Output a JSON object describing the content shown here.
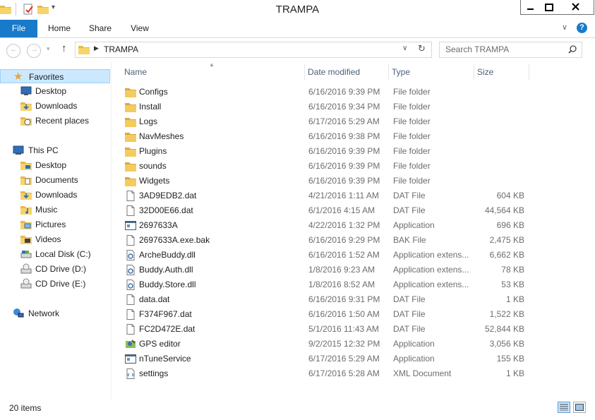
{
  "window": {
    "title": "TRAMPA"
  },
  "ribbon": {
    "tabs": [
      "File",
      "Home",
      "Share",
      "View"
    ],
    "help": "?"
  },
  "address": {
    "path": "TRAMPA"
  },
  "search": {
    "placeholder": "Search TRAMPA"
  },
  "nav": {
    "favorites": {
      "label": "Favorites",
      "items": [
        "Desktop",
        "Downloads",
        "Recent places"
      ]
    },
    "this_pc": {
      "label": "This PC",
      "items": [
        "Desktop",
        "Documents",
        "Downloads",
        "Music",
        "Pictures",
        "Videos",
        "Local Disk (C:)",
        "CD Drive (D:)",
        "CD Drive (E:)"
      ]
    },
    "network": {
      "label": "Network"
    }
  },
  "columns": {
    "name": "Name",
    "date": "Date modified",
    "type": "Type",
    "size": "Size"
  },
  "files": [
    {
      "name": "Configs",
      "date": "6/16/2016 9:39 PM",
      "type": "File folder",
      "size": "",
      "icon": "folder-icon"
    },
    {
      "name": "Install",
      "date": "6/16/2016 9:34 PM",
      "type": "File folder",
      "size": "",
      "icon": "folder-icon"
    },
    {
      "name": "Logs",
      "date": "6/17/2016 5:29 AM",
      "type": "File folder",
      "size": "",
      "icon": "folder-icon"
    },
    {
      "name": "NavMeshes",
      "date": "6/16/2016 9:38 PM",
      "type": "File folder",
      "size": "",
      "icon": "folder-icon"
    },
    {
      "name": "Plugins",
      "date": "6/16/2016 9:39 PM",
      "type": "File folder",
      "size": "",
      "icon": "folder-icon"
    },
    {
      "name": "sounds",
      "date": "6/16/2016 9:39 PM",
      "type": "File folder",
      "size": "",
      "icon": "folder-icon"
    },
    {
      "name": "Widgets",
      "date": "6/16/2016 9:39 PM",
      "type": "File folder",
      "size": "",
      "icon": "folder-icon"
    },
    {
      "name": "3AD9EDB2.dat",
      "date": "4/21/2016 1:11 AM",
      "type": "DAT File",
      "size": "604 KB",
      "icon": "file-icon"
    },
    {
      "name": "32D00E66.dat",
      "date": "6/1/2016 4:15 AM",
      "type": "DAT File",
      "size": "44,564 KB",
      "icon": "file-icon"
    },
    {
      "name": "2697633A",
      "date": "4/22/2016 1:32 PM",
      "type": "Application",
      "size": "696 KB",
      "icon": "application-icon"
    },
    {
      "name": "2697633A.exe.bak",
      "date": "6/16/2016 9:29 PM",
      "type": "BAK File",
      "size": "2,475 KB",
      "icon": "file-icon"
    },
    {
      "name": "ArcheBuddy.dll",
      "date": "6/16/2016 1:52 AM",
      "type": "Application extens...",
      "size": "6,662 KB",
      "icon": "dll-icon"
    },
    {
      "name": "Buddy.Auth.dll",
      "date": "1/8/2016 9:23 AM",
      "type": "Application extens...",
      "size": "78 KB",
      "icon": "dll-icon"
    },
    {
      "name": "Buddy.Store.dll",
      "date": "1/8/2016 8:52 AM",
      "type": "Application extens...",
      "size": "53 KB",
      "icon": "dll-icon"
    },
    {
      "name": "data.dat",
      "date": "6/16/2016 9:31 PM",
      "type": "DAT File",
      "size": "1 KB",
      "icon": "file-icon"
    },
    {
      "name": "F374F967.dat",
      "date": "6/16/2016 1:50 AM",
      "type": "DAT File",
      "size": "1,522 KB",
      "icon": "file-icon"
    },
    {
      "name": "FC2D472E.dat",
      "date": "5/1/2016 11:43 AM",
      "type": "DAT File",
      "size": "52,844 KB",
      "icon": "file-icon"
    },
    {
      "name": "GPS editor",
      "date": "9/2/2015 12:32 PM",
      "type": "Application",
      "size": "3,056 KB",
      "icon": "gps-editor-icon"
    },
    {
      "name": "nTuneService",
      "date": "6/17/2016 5:29 AM",
      "type": "Application",
      "size": "155 KB",
      "icon": "application-icon"
    },
    {
      "name": "settings",
      "date": "6/17/2016 5:28 AM",
      "type": "XML Document",
      "size": "1 KB",
      "icon": "xml-icon"
    }
  ],
  "status": {
    "count": "20 items"
  },
  "colors": {
    "file_tab": "#1979ca",
    "selected": "#cce8ff",
    "folder": "#e8b84a",
    "header_text": "#4c607a"
  }
}
